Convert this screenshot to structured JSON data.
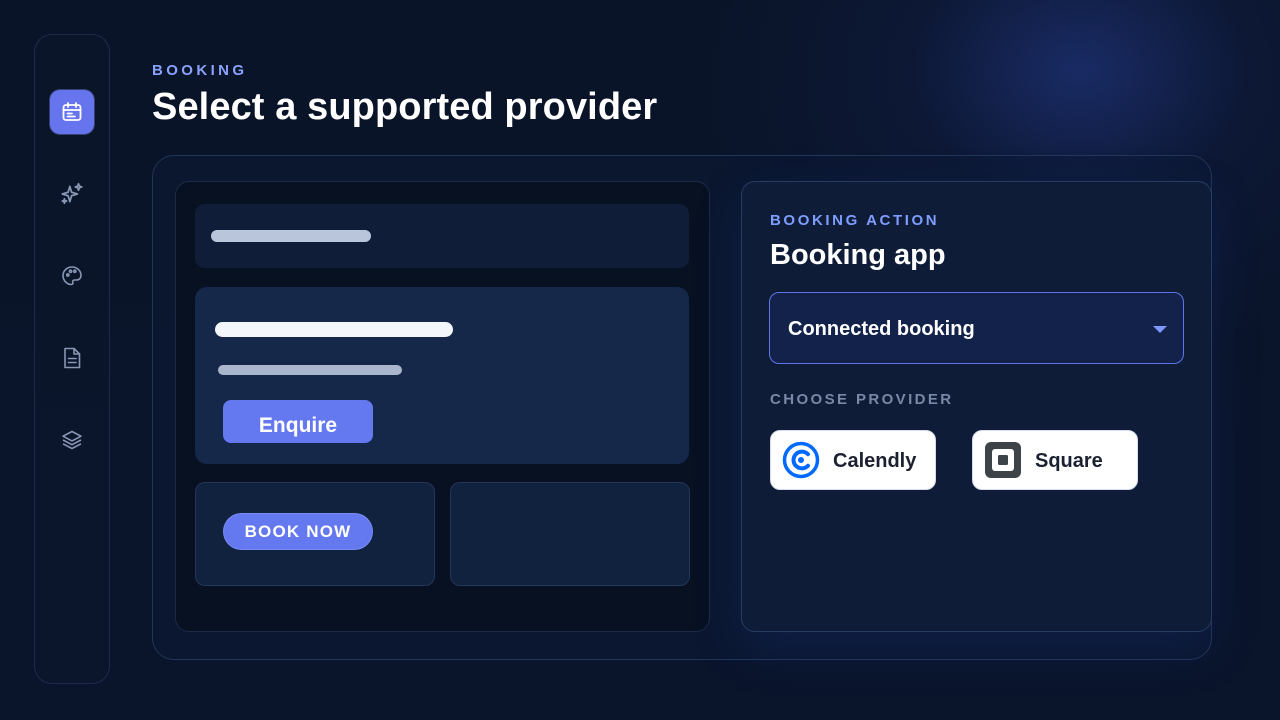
{
  "sidebar": {
    "items": [
      {
        "icon": "calendar-icon",
        "active": true
      },
      {
        "icon": "sparkles-icon",
        "active": false
      },
      {
        "icon": "palette-icon",
        "active": false
      },
      {
        "icon": "document-icon",
        "active": false
      },
      {
        "icon": "layers-icon",
        "active": false
      }
    ]
  },
  "header": {
    "eyebrow": "BOOKING",
    "title": "Select a supported provider"
  },
  "preview": {
    "enquire_label": "Enquire",
    "book_now_label": "BOOK NOW"
  },
  "settings": {
    "eyebrow": "BOOKING ACTION",
    "title": "Booking app",
    "select_value": "Connected booking",
    "providers_label": "CHOOSE PROVIDER",
    "providers": [
      {
        "name": "Calendly",
        "icon": "calendly-logo-icon",
        "color": "#0069ff"
      },
      {
        "name": "Square",
        "icon": "square-logo-icon",
        "color": "#3e4348"
      }
    ]
  },
  "colors": {
    "background": "#0a1428",
    "accent": "#6478f0",
    "accent_text": "#8aa2ff",
    "panel": "#0f1c38"
  }
}
